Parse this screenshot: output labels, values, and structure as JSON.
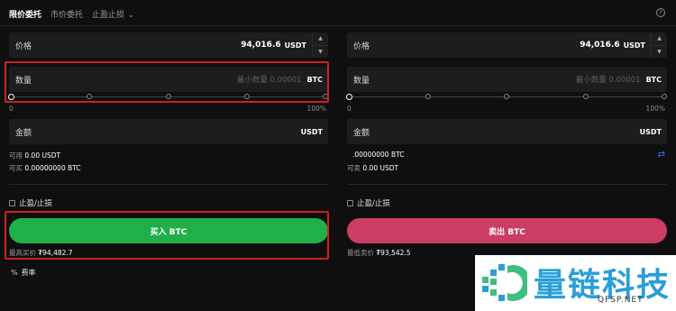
{
  "tabs": {
    "limit": "限价委托",
    "market": "市价委托",
    "tpsl": "止盈止损"
  },
  "help_icon": "?",
  "buy": {
    "price_label": "价格",
    "price_value": "94,016.6",
    "price_unit": "USDT",
    "qty_label": "数量",
    "qty_placeholder": "最小数量 0.00001",
    "qty_unit": "BTC",
    "pct_min": "0",
    "pct_max": "100%",
    "amount_label": "金额",
    "amount_unit": "USDT",
    "avail_label": "可用",
    "avail_value": "0.00 USDT",
    "canbuy_label": "可买",
    "canbuy_value": "0.00000000 BTC",
    "tpsl_label": "止盈/止损",
    "button": "买入 BTC",
    "ref_label": "最高买价",
    "ref_value": "₮94,482.7"
  },
  "sell": {
    "price_label": "价格",
    "price_value": "94,016.6",
    "price_unit": "USDT",
    "qty_label": "数量",
    "qty_placeholder": "最小数量 0.00001",
    "qty_unit": "BTC",
    "pct_min": "0",
    "pct_max": "100%",
    "amount_label": "金额",
    "amount_unit": "USDT",
    "avail_value": ".00000000 BTC",
    "cansell_label": "可卖",
    "cansell_value": "0.00 USDT",
    "tpsl_label": "止盈/止损",
    "button": "卖出 BTC",
    "ref_label": "最低卖价",
    "ref_value": "₮93,542.5"
  },
  "fee_label": "费率",
  "watermark": {
    "name": "量链科技",
    "url": "QFSP.NET"
  },
  "colors": {
    "buy": "#20b04a",
    "sell": "#cc3d63",
    "highlight": "#d11f1f",
    "background": "#0f0f10"
  },
  "icons": [
    "chevron-down-icon",
    "help-icon",
    "swap-icon",
    "percent-icon",
    "checkbox-icon"
  ]
}
